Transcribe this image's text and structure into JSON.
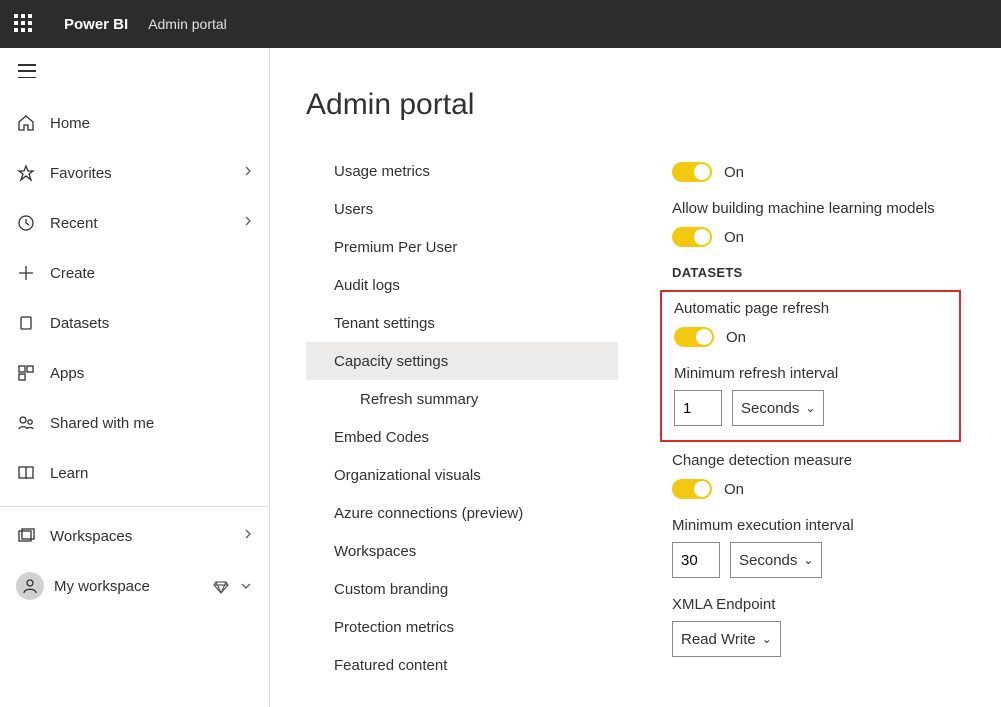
{
  "topbar": {
    "brand": "Power BI",
    "portal": "Admin portal"
  },
  "sidebar": {
    "items": [
      {
        "label": "Home"
      },
      {
        "label": "Favorites"
      },
      {
        "label": "Recent"
      },
      {
        "label": "Create"
      },
      {
        "label": "Datasets"
      },
      {
        "label": "Apps"
      },
      {
        "label": "Shared with me"
      },
      {
        "label": "Learn"
      }
    ],
    "workspaces_label": "Workspaces",
    "my_workspace_label": "My workspace"
  },
  "page": {
    "title": "Admin portal"
  },
  "settings_menu": [
    "Usage metrics",
    "Users",
    "Premium Per User",
    "Audit logs",
    "Tenant settings",
    "Capacity settings",
    "Refresh summary",
    "Embed Codes",
    "Organizational visuals",
    "Azure connections (preview)",
    "Workspaces",
    "Custom branding",
    "Protection metrics",
    "Featured content"
  ],
  "pane": {
    "toggle_on": "On",
    "allow_ml": "Allow building machine learning models",
    "datasets_hdr": "DATASETS",
    "auto_refresh": "Automatic page refresh",
    "min_refresh": "Minimum refresh interval",
    "min_refresh_val": "1",
    "unit_seconds": "Seconds",
    "change_detect": "Change detection measure",
    "min_exec": "Minimum execution interval",
    "min_exec_val": "30",
    "xmla": "XMLA Endpoint",
    "xmla_val": "Read Write"
  }
}
